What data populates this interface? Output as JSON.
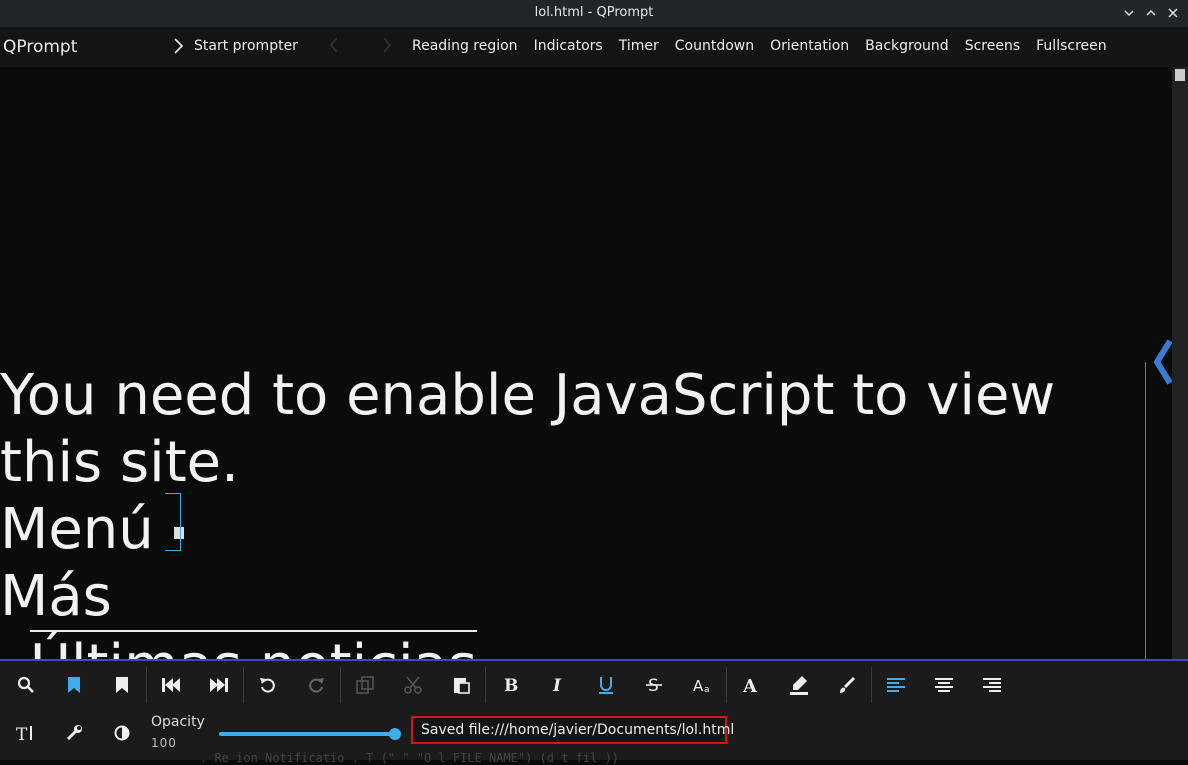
{
  "window": {
    "title": "lol.html - QPrompt"
  },
  "menubar": {
    "app_name": "QPrompt",
    "start_label": "Start prompter",
    "items": [
      "Reading region",
      "Indicators",
      "Timer",
      "Countdown",
      "Orientation",
      "Background",
      "Screens",
      "Fullscreen"
    ]
  },
  "editor": {
    "lines": [
      "You need to enable JavaScript to view",
      "this site.",
      "Menú",
      "Más",
      "Últimas noticias"
    ]
  },
  "toolbar": {
    "opacity_label": "Opacity",
    "opacity_value": "100",
    "opacity_level": 1.0,
    "status": "Saved file:///home/javier/Documents/lol.html",
    "ghost_text": "  . Re  ion Notificatio  . T (\"      \"  \"O    l FILE NAME\")     (d    t fil ))"
  },
  "colors": {
    "accent": "#3daee9",
    "status_border": "#e01010",
    "toolbar_border": "#3b4cba"
  },
  "icons": [
    "search-icon",
    "bookmark-filled-icon",
    "bookmark-icon",
    "skip-back-icon",
    "skip-forward-icon",
    "undo-icon",
    "redo-icon",
    "copy-icon",
    "cut-icon",
    "paste-icon",
    "bold-icon",
    "italic-icon",
    "underline-icon",
    "strikethrough-icon",
    "font-size-icon",
    "font-icon",
    "highlight-icon",
    "paint-brush-icon",
    "align-left-icon",
    "align-center-icon",
    "align-right-icon",
    "text-settings-icon",
    "wrench-icon",
    "contrast-icon"
  ]
}
